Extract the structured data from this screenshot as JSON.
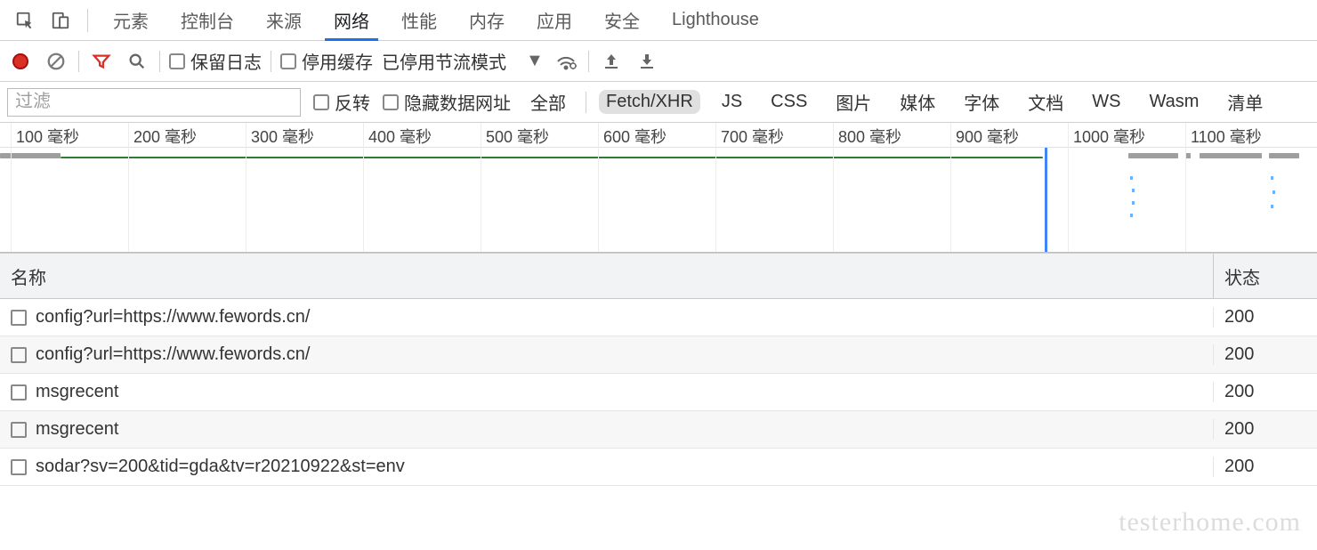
{
  "tabs": [
    "元素",
    "控制台",
    "来源",
    "网络",
    "性能",
    "内存",
    "应用",
    "安全",
    "Lighthouse"
  ],
  "active_tab_index": 3,
  "toolbar": {
    "preserve_log": "保留日志",
    "disable_cache": "停用缓存",
    "throttling_label": "已停用节流模式"
  },
  "filterbar": {
    "placeholder": "过滤",
    "invert": "反转",
    "hide_data_urls": "隐藏数据网址",
    "types": [
      "全部",
      "Fetch/XHR",
      "JS",
      "CSS",
      "图片",
      "媒体",
      "字体",
      "文档",
      "WS",
      "Wasm",
      "清单"
    ],
    "active_type_index": 1
  },
  "timeline": {
    "unit": "毫秒",
    "ticks": [
      100,
      200,
      300,
      400,
      500,
      600,
      700,
      800,
      900,
      1000,
      1100
    ]
  },
  "table": {
    "headers": {
      "name": "名称",
      "status": "状态"
    },
    "rows": [
      {
        "name": "config?url=https://www.fewords.cn/",
        "status": "200"
      },
      {
        "name": "config?url=https://www.fewords.cn/",
        "status": "200"
      },
      {
        "name": "msgrecent",
        "status": "200"
      },
      {
        "name": "msgrecent",
        "status": "200"
      },
      {
        "name": "sodar?sv=200&tid=gda&tv=r20210922&st=env",
        "status": "200"
      }
    ]
  },
  "watermark": "testerhome.com"
}
